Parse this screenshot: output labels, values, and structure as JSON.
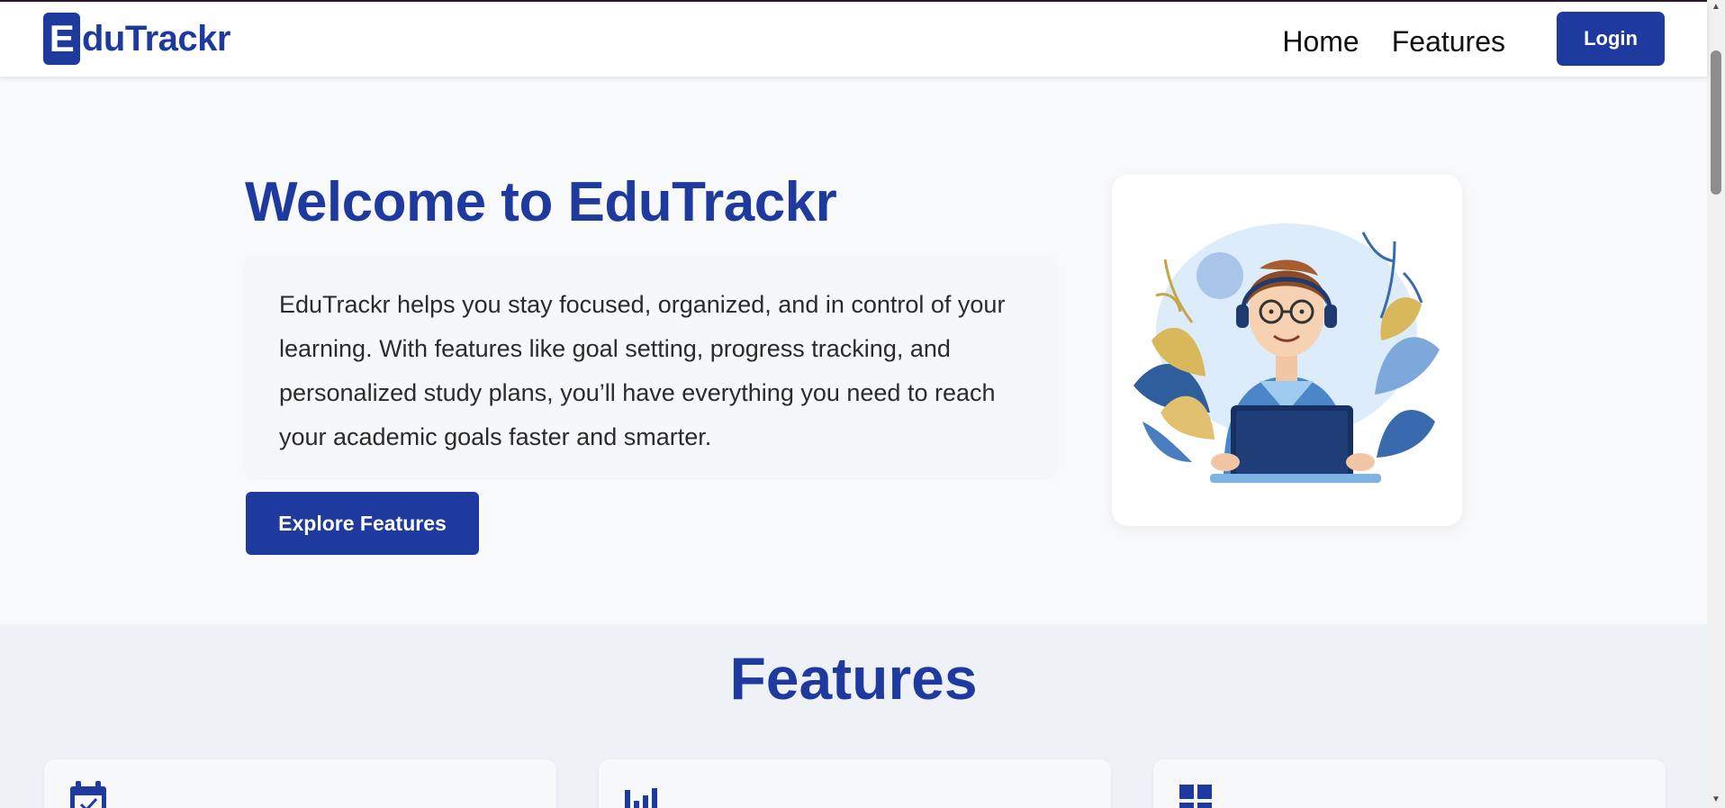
{
  "navbar": {
    "logo_letter": "E",
    "logo_rest": "duTrackr",
    "links": [
      {
        "label": "Home"
      },
      {
        "label": "Features"
      }
    ],
    "login_label": "Login"
  },
  "hero": {
    "title": "Welcome to EduTrackr",
    "description": "EduTrackr helps you stay focused, organized, and in control of your learning. With features like goal setting, progress tracking, and personalized study plans, you’ll have everything you need to reach your academic goals faster and smarter.",
    "cta_label": "Explore Features",
    "illustration": "student-with-laptop-illustration"
  },
  "features": {
    "title": "Features",
    "cards": [
      {
        "icon": "calendar-icon"
      },
      {
        "icon": "bar-chart-icon"
      },
      {
        "icon": "grid-icon"
      }
    ]
  },
  "colors": {
    "brand": "#1e3a9e",
    "page_bg": "#f8f9fb",
    "section_bg": "#eef2f7"
  }
}
